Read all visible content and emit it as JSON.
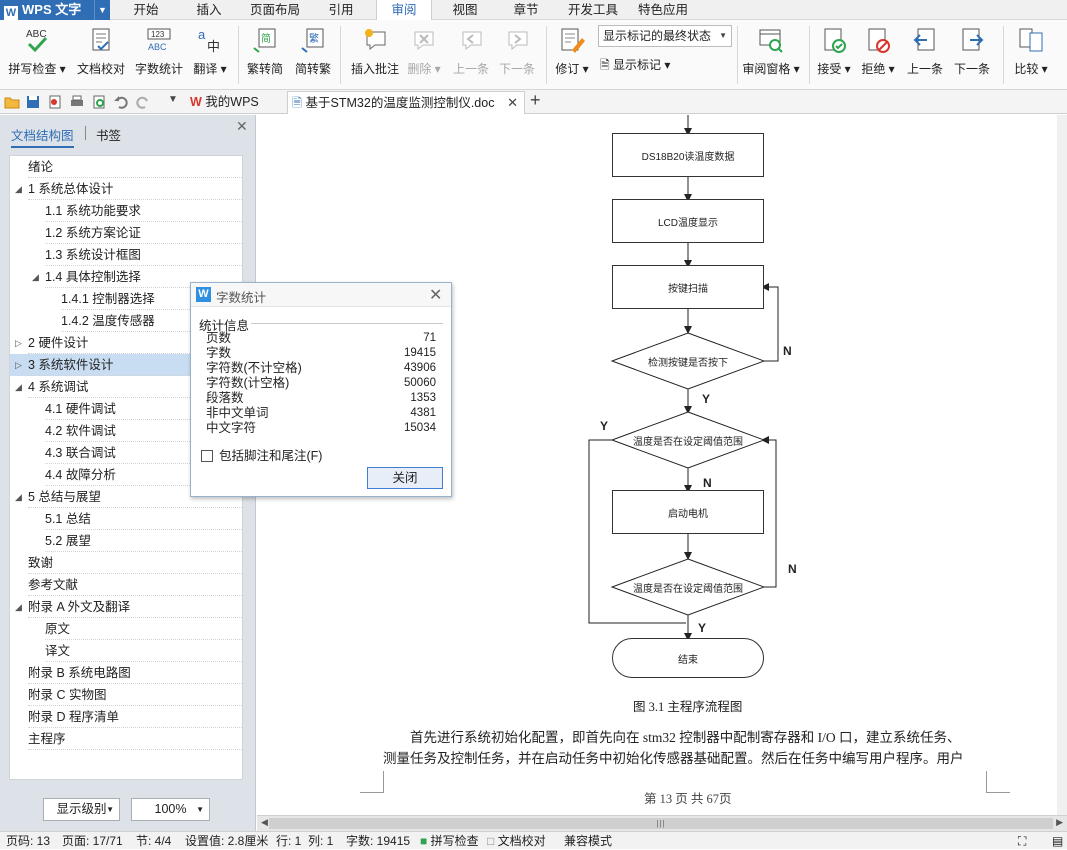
{
  "app": {
    "name": "WPS 文字",
    "logo": "W"
  },
  "menu_tabs": [
    "开始",
    "插入",
    "页面布局",
    "引用",
    "审阅",
    "视图",
    "章节",
    "开发工具",
    "特色应用"
  ],
  "ribbon": {
    "spell_check": "拼写检查",
    "doc_proof": "文档校对",
    "word_count": "字数统计",
    "translate": "翻译",
    "to_simplified": "繁转简",
    "to_traditional": "简转繁",
    "insert_comment": "插入批注",
    "delete": "删除",
    "prev": "上一条",
    "next": "下一条",
    "revise": "修订",
    "markup_select": "显示标记的最终状态",
    "show_markup": "显示标记",
    "review_pane": "审阅窗格",
    "accept": "接受",
    "reject": "拒绝",
    "prev2": "上一条",
    "next2": "下一条",
    "compare": "比较"
  },
  "doc_tabs": {
    "mywps": "我的WPS",
    "document": "基于STM32的温度监测控制仪.doc"
  },
  "nav": {
    "tab_outline": "文档结构图",
    "tab_bookmarks": "书签",
    "items": [
      {
        "label": "绪论",
        "level": 0,
        "tri": ""
      },
      {
        "label": "1  系统总体设计",
        "level": 0,
        "tri": "◢"
      },
      {
        "label": "1.1 系统功能要求",
        "level": 1,
        "tri": ""
      },
      {
        "label": "1.2 系统方案论证",
        "level": 1,
        "tri": ""
      },
      {
        "label": "1.3 系统设计框图",
        "level": 1,
        "tri": ""
      },
      {
        "label": "1.4  具体控制选择",
        "level": 1,
        "tri": "◢"
      },
      {
        "label": "1.4.1  控制器选择",
        "level": 2,
        "tri": ""
      },
      {
        "label": "1.4.2  温度传感器",
        "level": 2,
        "tri": ""
      },
      {
        "label": "2  硬件设计",
        "level": 0,
        "tri": "▷"
      },
      {
        "label": "3  系统软件设计",
        "level": 0,
        "tri": "▷"
      },
      {
        "label": "4  系统调试",
        "level": 0,
        "tri": "◢"
      },
      {
        "label": "4.1  硬件调试",
        "level": 1,
        "tri": ""
      },
      {
        "label": "4.2  软件调试",
        "level": 1,
        "tri": ""
      },
      {
        "label": "4.3  联合调试",
        "level": 1,
        "tri": ""
      },
      {
        "label": "4.4  故障分析",
        "level": 1,
        "tri": ""
      },
      {
        "label": "5  总结与展望",
        "level": 0,
        "tri": "◢"
      },
      {
        "label": "5.1  总结",
        "level": 1,
        "tri": ""
      },
      {
        "label": "5.2  展望",
        "level": 1,
        "tri": ""
      },
      {
        "label": "致谢",
        "level": 0,
        "tri": ""
      },
      {
        "label": "参考文献",
        "level": 0,
        "tri": ""
      },
      {
        "label": "附录 A    外文及翻译",
        "level": 0,
        "tri": "◢"
      },
      {
        "label": "原文",
        "level": 1,
        "tri": ""
      },
      {
        "label": "译文",
        "level": 1,
        "tri": ""
      },
      {
        "label": "附录 B  系统电路图",
        "level": 0,
        "tri": ""
      },
      {
        "label": "附录 C  实物图",
        "level": 0,
        "tri": ""
      },
      {
        "label": "附录 D  程序清单",
        "level": 0,
        "tri": ""
      },
      {
        "label": "主程序",
        "level": 0,
        "tri": ""
      }
    ],
    "selected": "3  系统软件设计",
    "display_level": "显示级别",
    "zoom": "100%"
  },
  "flowchart": {
    "read_temp": "DS18B20读温度数据",
    "lcd_show": "LCD温度显示",
    "key_scan": "按键扫描",
    "key_check": "检测按键是否按下",
    "temp_check1": "温度是否在设定阈值范围",
    "motor_start": "启动电机",
    "temp_check2": "温度是否在设定阈值范围",
    "end": "结束",
    "n": "N",
    "y": "Y"
  },
  "caption": "图 3.1  主程序流程图",
  "body": {
    "line1": "首先进行系统初始化配置，即首先向在 stm32 控制器中配制寄存器和 I/O 口，建立系统任务、",
    "line2": "测量任务及控制任务，并在启动任务中初始化传感器基础配置。然后在任务中编写用户程序。用户"
  },
  "footer": "第 13 页 共 67页",
  "status": {
    "page_code": "页码: 13",
    "page": "页面: 17/71",
    "section": "节: 4/4",
    "setting": "设置值: 2.8厘米",
    "row": "行: 1",
    "col": "列: 1",
    "words": "字数: 19415",
    "spell": "拼写检查",
    "proof": "文档校对",
    "compat": "兼容模式"
  },
  "dialog": {
    "title": "字数统计",
    "group": "统计信息",
    "rows": [
      {
        "label": "页数",
        "value": "71"
      },
      {
        "label": "字数",
        "value": "19415"
      },
      {
        "label": "字符数(不计空格)",
        "value": "43906"
      },
      {
        "label": "字符数(计空格)",
        "value": "50060"
      },
      {
        "label": "段落数",
        "value": "1353"
      },
      {
        "label": "非中文单词",
        "value": "4381"
      },
      {
        "label": "中文字符",
        "value": "15034"
      }
    ],
    "checkbox": "包括脚注和尾注(F)",
    "close": "关闭"
  },
  "colors": {
    "accent": "#2f6eb5",
    "nav_bg": "#dde2e8",
    "selected": "#c9ddf2"
  }
}
